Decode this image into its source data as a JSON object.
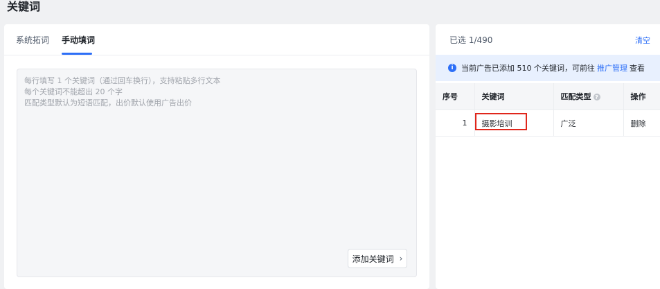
{
  "page": {
    "title": "关键词"
  },
  "left": {
    "tabs": [
      {
        "label": "系统拓词",
        "active": false
      },
      {
        "label": "手动填词",
        "active": true
      }
    ],
    "textarea": {
      "placeholder_lines": [
        "每行填写 1 个关键词（通过回车换行），支持粘贴多行文本",
        "每个关键词不能超出 20 个字",
        "匹配类型默认为短语匹配，出价默认使用广告出价"
      ]
    },
    "add_button": {
      "label": "添加关键词",
      "icon": "chevron-right-icon"
    }
  },
  "right": {
    "selected_count": "已选 1/490",
    "clear_label": "清空",
    "info": {
      "icon": "info-icon",
      "text_before": "当前广告已添加 510 个关键词，可前往",
      "link": "推广管理",
      "text_after": "查看"
    },
    "table": {
      "headers": [
        "序号",
        "关键词",
        "匹配类型",
        "操作"
      ],
      "help_icon": "question-circle-icon",
      "rows": [
        {
          "index": "1",
          "keyword": "摄影培训",
          "match_type": "广泛",
          "action": "删除"
        }
      ]
    }
  },
  "colors": {
    "accent": "#2d6ff7",
    "highlight": "#e0261b",
    "info_bg": "#e8f0fe"
  }
}
